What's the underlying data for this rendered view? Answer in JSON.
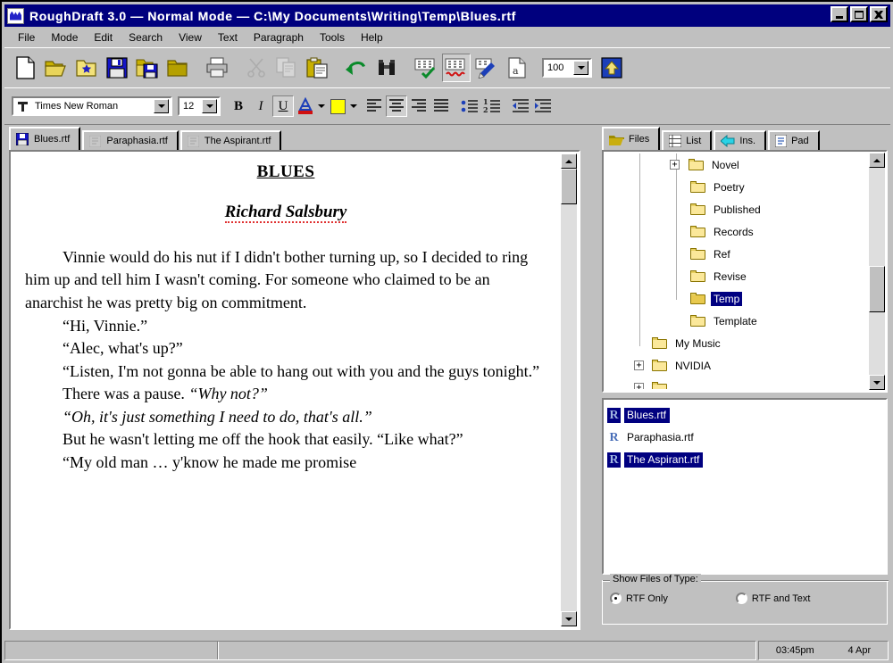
{
  "window": {
    "title": "RoughDraft 3.0  —  Normal Mode  —  C:\\My Documents\\Writing\\Temp\\Blues.rtf",
    "app_name": "RoughDraft 3.0",
    "mode": "Normal Mode",
    "file_path": "C:\\My Documents\\Writing\\Temp\\Blues.rtf",
    "buttons": {
      "minimize": "_",
      "maximize": "□",
      "close": "✕"
    }
  },
  "menu": {
    "items": [
      "File",
      "Mode",
      "Edit",
      "Search",
      "View",
      "Text",
      "Paragraph",
      "Tools",
      "Help"
    ]
  },
  "toolbar": {
    "items": [
      {
        "name": "new-document",
        "label": "New"
      },
      {
        "name": "open-document",
        "label": "Open"
      },
      {
        "name": "open-favorite",
        "label": "Open Favorite"
      },
      {
        "name": "save-document",
        "label": "Save"
      },
      {
        "name": "save-as",
        "label": "Save As"
      },
      {
        "name": "save-all",
        "label": "Save All"
      },
      {
        "name": "print",
        "label": "Print"
      },
      {
        "name": "cut",
        "label": "Cut"
      },
      {
        "name": "copy",
        "label": "Copy"
      },
      {
        "name": "paste",
        "label": "Paste"
      },
      {
        "name": "undo",
        "label": "Undo"
      },
      {
        "name": "find",
        "label": "Find"
      },
      {
        "name": "spell-check",
        "label": "Spell Check"
      },
      {
        "name": "spell-as-you-type",
        "label": "Spell As You Type"
      },
      {
        "name": "thesaurus",
        "label": "Thesaurus"
      },
      {
        "name": "special-character",
        "label": "Insert Special Character"
      },
      {
        "name": "zoom",
        "label": "Zoom"
      },
      {
        "name": "full-screen",
        "label": "Full Screen"
      }
    ],
    "zoom_value": "100"
  },
  "format_bar": {
    "font_name": "Times New Roman",
    "font_size": "12",
    "bold_label": "B",
    "italic_label": "I",
    "underline_label": "U",
    "font_color_label": "A",
    "highlight_color": "#ffff00",
    "buttons": [
      {
        "name": "align-left",
        "label": "Align Left",
        "active": false
      },
      {
        "name": "align-center",
        "label": "Center",
        "active": true
      },
      {
        "name": "align-right",
        "label": "Align Right",
        "active": false
      },
      {
        "name": "justify",
        "label": "Justify",
        "active": false
      },
      {
        "name": "bullet-list",
        "label": "Bullets",
        "active": false
      },
      {
        "name": "numbered-list",
        "label": "Numbering",
        "active": false
      },
      {
        "name": "decrease-indent",
        "label": "Decrease Indent",
        "active": false
      },
      {
        "name": "increase-indent",
        "label": "Increase Indent",
        "active": false
      }
    ]
  },
  "document_tabs": [
    {
      "label": "Blues.rtf",
      "active": true,
      "icon": "save-icon"
    },
    {
      "label": "Paraphasia.rtf",
      "active": false,
      "icon": "document-icon"
    },
    {
      "label": "The Aspirant.rtf",
      "active": false,
      "icon": "document-icon"
    }
  ],
  "panel_tabs": [
    {
      "label": "Files",
      "active": true,
      "icon": "folder-icon"
    },
    {
      "label": "List",
      "active": false,
      "icon": "list-icon"
    },
    {
      "label": "Ins.",
      "active": false,
      "icon": "insert-arrow-icon"
    },
    {
      "label": "Pad",
      "active": false,
      "icon": "notepad-icon"
    }
  ],
  "document": {
    "title": "BLUES",
    "author": "Richard Salsbury",
    "paragraphs": [
      {
        "id": "p1",
        "text": "Vinnie would do his nut if I didn't bother turning up, so I decided to ring him up and tell him I wasn't coming. For someone who claimed to be an anarchist he was pretty big on commitment."
      },
      {
        "id": "p2",
        "text": "“Hi, Vinnie.”"
      },
      {
        "id": "p3",
        "text": "“Alec, what's up?”"
      },
      {
        "id": "p4",
        "text": "“Listen, I'm not gonna be able to hang out with you and the guys tonight.”"
      },
      {
        "id": "p5a",
        "text": "There was a pause. "
      },
      {
        "id": "p5b",
        "text": "“Why not?”"
      },
      {
        "id": "p6",
        "text": "“Oh, it's just something I need to do, that's all.”"
      },
      {
        "id": "p7",
        "text": "But he wasn't letting me off the hook that easily. “Like what?”"
      },
      {
        "id": "p8",
        "text": "“My old man … y'know he made me promise"
      }
    ]
  },
  "file_tree": {
    "nodes": [
      {
        "label": "Novel",
        "indent": 3,
        "expander": "+",
        "selected": false
      },
      {
        "label": "Poetry",
        "indent": 3,
        "expander": "",
        "selected": false
      },
      {
        "label": "Published",
        "indent": 3,
        "expander": "",
        "selected": false
      },
      {
        "label": "Records",
        "indent": 3,
        "expander": "",
        "selected": false
      },
      {
        "label": "Ref",
        "indent": 3,
        "expander": "",
        "selected": false
      },
      {
        "label": "Revise",
        "indent": 3,
        "expander": "",
        "selected": false
      },
      {
        "label": "Temp",
        "indent": 3,
        "expander": "",
        "selected": true
      },
      {
        "label": "Template",
        "indent": 3,
        "expander": "",
        "selected": false
      },
      {
        "label": "My Music",
        "indent": 2,
        "expander": "",
        "selected": false
      },
      {
        "label": "NVIDIA",
        "indent": 2,
        "expander": "+",
        "selected": false
      }
    ]
  },
  "file_list": {
    "items": [
      {
        "label": "Blues.rtf",
        "selected": true
      },
      {
        "label": "Paraphasia.rtf",
        "selected": false
      },
      {
        "label": "The Aspirant.rtf",
        "selected": true
      }
    ]
  },
  "file_type_group": {
    "title": "Show Files of Type:",
    "options": [
      {
        "label": "RTF Only",
        "selected": true
      },
      {
        "label": "RTF and Text",
        "selected": false
      }
    ]
  },
  "status_bar": {
    "left_panel": "",
    "middle_panel": "",
    "time": "03:45pm",
    "date": "4 Apr"
  },
  "colors": {
    "titlebar": "#00007e",
    "selection": "#000080",
    "face": "#c0c0c0",
    "highlight_yellow": "#ffff00",
    "spell_error": "#e03030"
  }
}
